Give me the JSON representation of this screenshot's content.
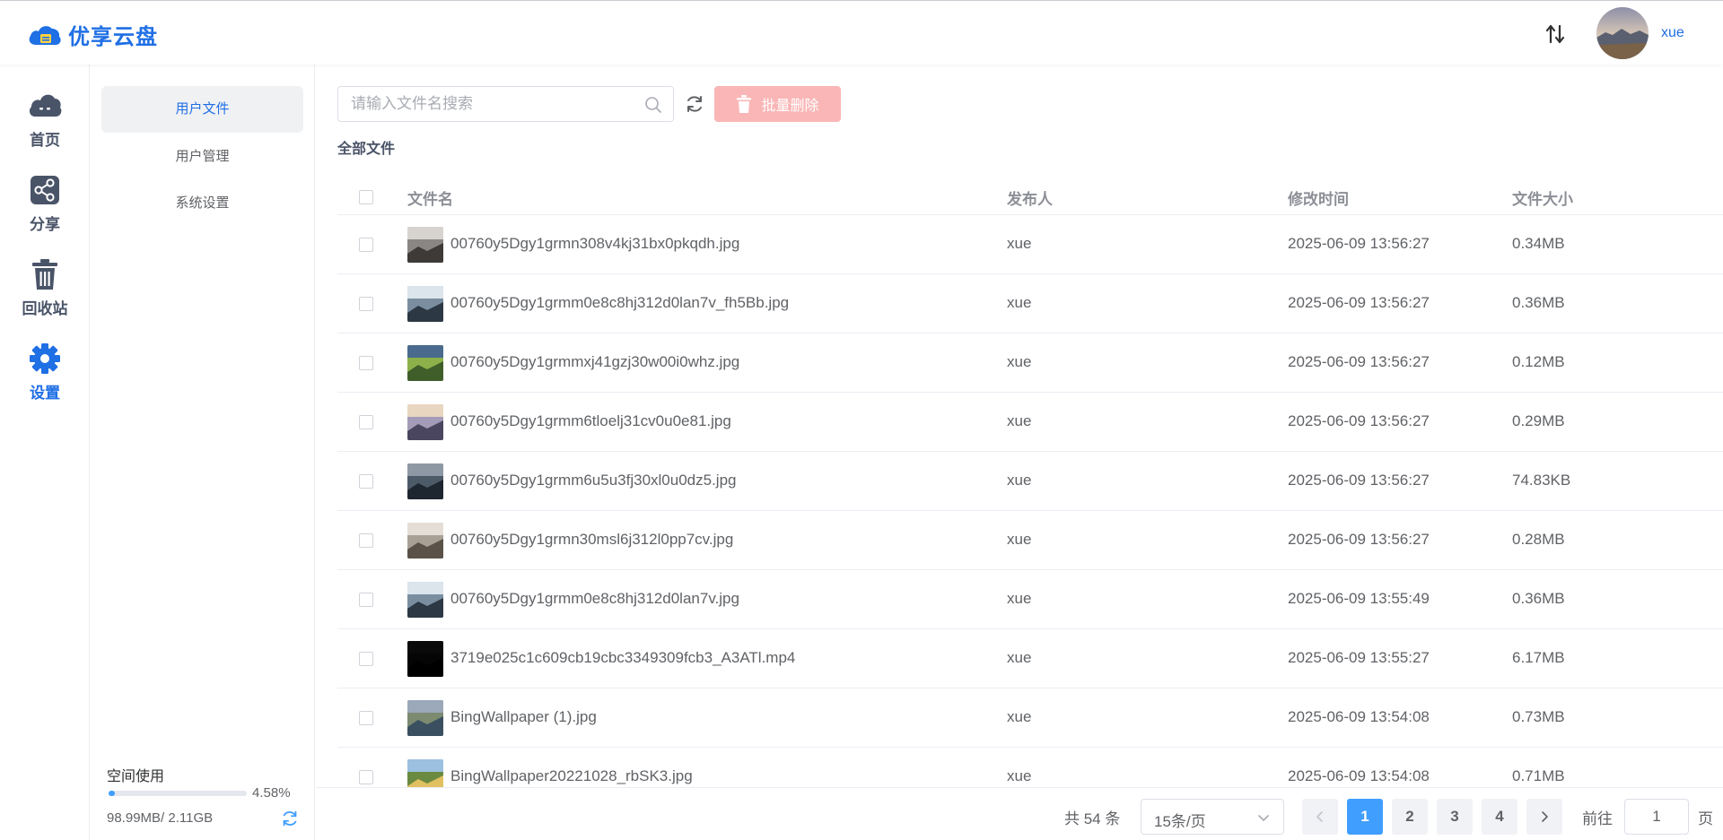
{
  "app": {
    "name": "优享云盘"
  },
  "header": {
    "username": "xue"
  },
  "nav": [
    {
      "label": "首页",
      "icon": "cloud-icon"
    },
    {
      "label": "分享",
      "icon": "share-icon"
    },
    {
      "label": "回收站",
      "icon": "trash-icon"
    },
    {
      "label": "设置",
      "icon": "gear-icon",
      "active": true
    }
  ],
  "submenu": [
    {
      "label": "用户文件",
      "active": true
    },
    {
      "label": "用户管理"
    },
    {
      "label": "系统设置"
    }
  ],
  "storage": {
    "title": "空间使用",
    "percent_label": "4.58%",
    "percent": 4.58,
    "size_label": "98.99MB/ 2.11GB"
  },
  "toolbar": {
    "search_placeholder": "请输入文件名搜索",
    "batch_delete_label": "批量删除"
  },
  "breadcrumb": "全部文件",
  "table": {
    "columns": [
      "文件名",
      "发布人",
      "修改时间",
      "文件大小"
    ],
    "rows": [
      {
        "name": "00760y5Dgy1grmn308v4kj31bx0pkqdh.jpg",
        "publisher": "xue",
        "modified": "2025-06-09 13:56:27",
        "size": "0.34MB"
      },
      {
        "name": "00760y5Dgy1grmm0e8c8hj312d0lan7v_fh5Bb.jpg",
        "publisher": "xue",
        "modified": "2025-06-09 13:56:27",
        "size": "0.36MB"
      },
      {
        "name": "00760y5Dgy1grmmxj41gzj30w00i0whz.jpg",
        "publisher": "xue",
        "modified": "2025-06-09 13:56:27",
        "size": "0.12MB"
      },
      {
        "name": "00760y5Dgy1grmm6tloelj31cv0u0e81.jpg",
        "publisher": "xue",
        "modified": "2025-06-09 13:56:27",
        "size": "0.29MB"
      },
      {
        "name": "00760y5Dgy1grmm6u5u3fj30xl0u0dz5.jpg",
        "publisher": "xue",
        "modified": "2025-06-09 13:56:27",
        "size": "74.83KB"
      },
      {
        "name": "00760y5Dgy1grmn30msl6j312l0pp7cv.jpg",
        "publisher": "xue",
        "modified": "2025-06-09 13:56:27",
        "size": "0.28MB"
      },
      {
        "name": "00760y5Dgy1grmm0e8c8hj312d0lan7v.jpg",
        "publisher": "xue",
        "modified": "2025-06-09 13:55:49",
        "size": "0.36MB"
      },
      {
        "name": "3719e025c1c609cb19cbc3349309fcb3_A3ATl.mp4",
        "publisher": "xue",
        "modified": "2025-06-09 13:55:27",
        "size": "6.17MB"
      },
      {
        "name": "BingWallpaper (1).jpg",
        "publisher": "xue",
        "modified": "2025-06-09 13:54:08",
        "size": "0.73MB"
      },
      {
        "name": "BingWallpaper20221028_rbSK3.jpg",
        "publisher": "xue",
        "modified": "2025-06-09 13:54:08",
        "size": "0.71MB"
      }
    ]
  },
  "pagination": {
    "total_label": "共 54 条",
    "page_size_label": "15条/页",
    "pages": [
      "1",
      "2",
      "3",
      "4"
    ],
    "current_page": "1",
    "goto_label": "前往",
    "goto_value": "1",
    "page_unit": "页"
  },
  "colors": {
    "brand": "#1f6fe5",
    "primary": "#409eff",
    "danger_disabled": "#fab6b6"
  }
}
